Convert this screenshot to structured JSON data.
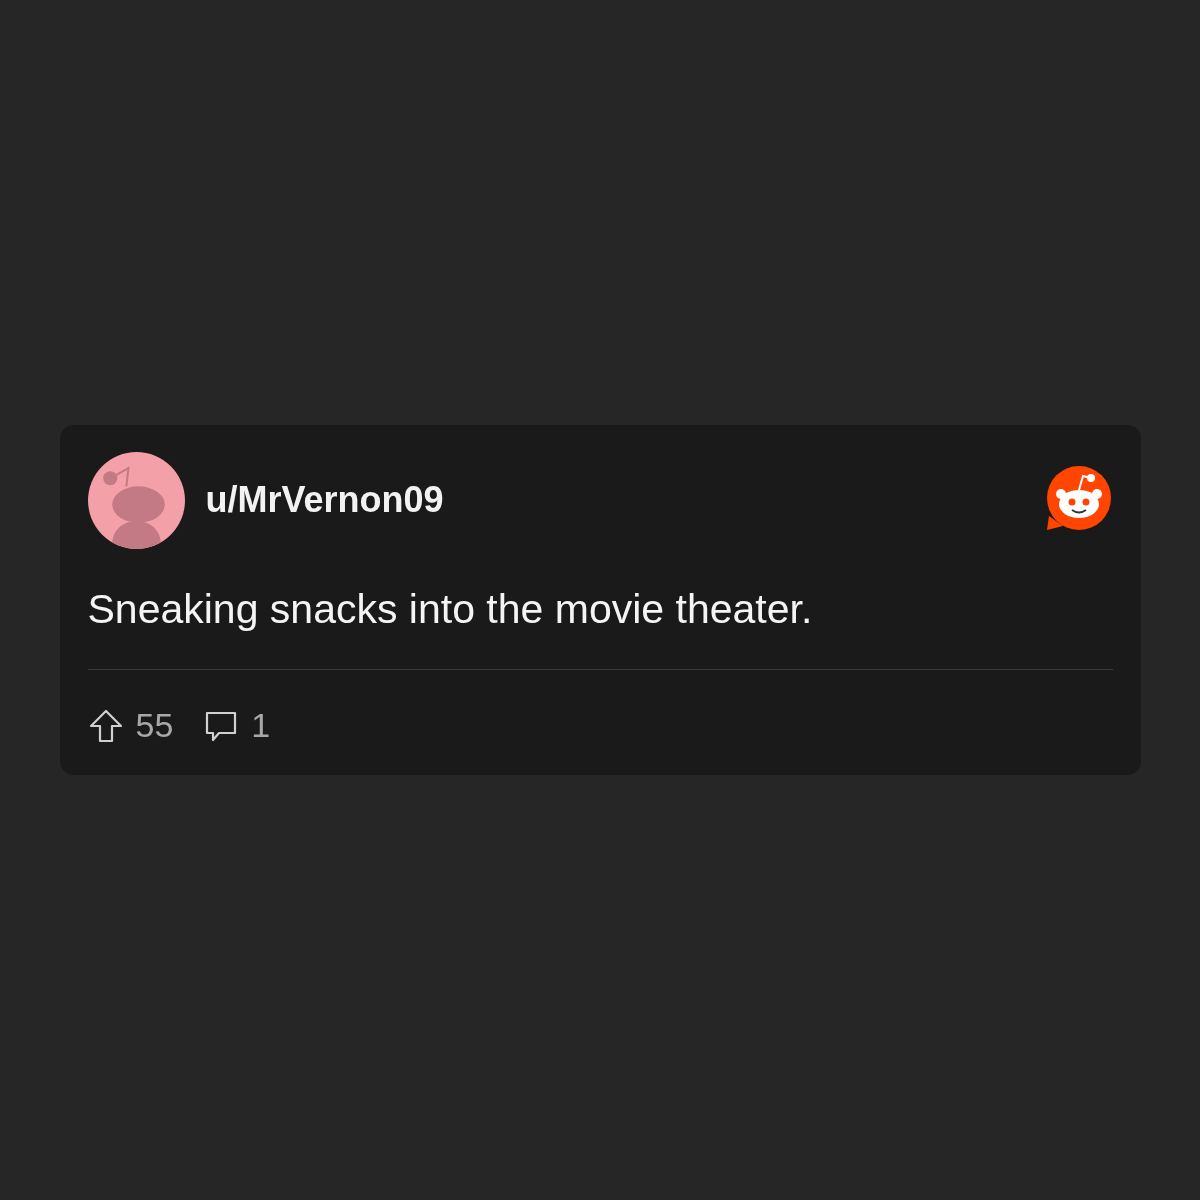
{
  "post": {
    "username": "u/MrVernon09",
    "body": "Sneaking snacks into the movie theater.",
    "upvotes": "55",
    "comments": "1"
  }
}
